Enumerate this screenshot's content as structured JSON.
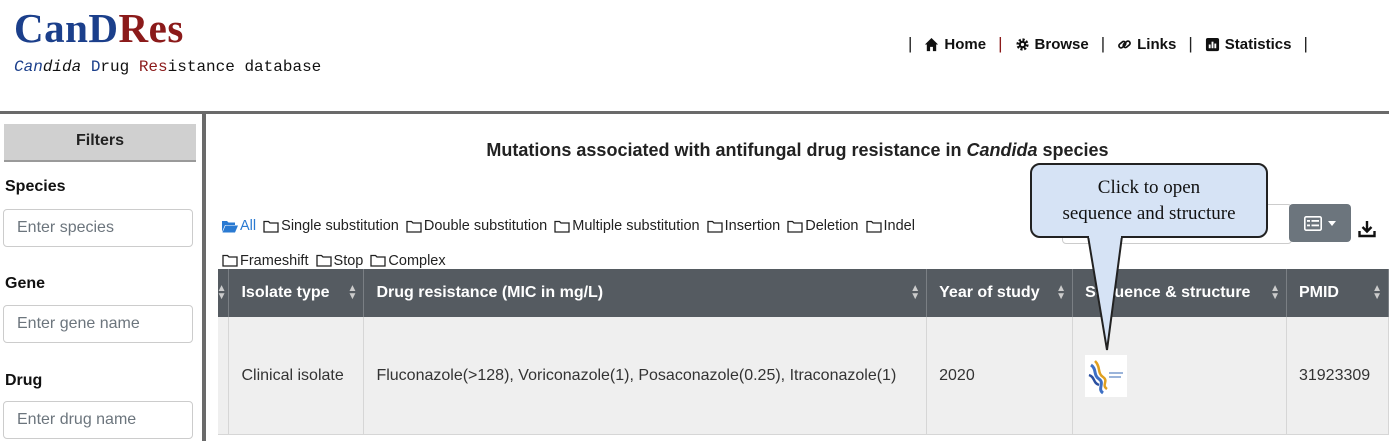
{
  "brand": {
    "logo_part1": "CanD",
    "logo_part2": "Res",
    "tagline_parts": [
      "Can",
      "dida",
      " D",
      "rug ",
      "Res",
      "istance database"
    ]
  },
  "nav": {
    "items": [
      {
        "label": "Home",
        "icon": "home-icon"
      },
      {
        "label": "Browse",
        "icon": "gear-icon"
      },
      {
        "label": "Links",
        "icon": "link-icon"
      },
      {
        "label": "Statistics",
        "icon": "bar-chart-icon"
      }
    ],
    "separator": "|"
  },
  "sidebar": {
    "title": "Filters",
    "filters": [
      {
        "label": "Species",
        "placeholder": "Enter species"
      },
      {
        "label": "Gene",
        "placeholder": "Enter gene name"
      },
      {
        "label": "Drug",
        "placeholder": "Enter drug name"
      }
    ]
  },
  "main": {
    "title_part1": "Mutations associated with antifungal drug resistance in ",
    "title_italic": "Candida",
    "title_part2": " species",
    "mutation_types": [
      "All",
      "Single substitution",
      "Double substitution",
      "Multiple substitution",
      "Insertion",
      "Deletion",
      "Indel",
      "Frameshift",
      "Stop",
      "Complex"
    ],
    "active_type": "All"
  },
  "table": {
    "headers": [
      "Isolate type",
      "Drug resistance (MIC in mg/L)",
      "Year of study",
      "Sequence & structure",
      "PMID"
    ],
    "rows": [
      {
        "isolate_type": "Clinical isolate",
        "drug_resistance": "Fluconazole(>128), Voriconazole(1), Posaconazole(0.25), Itraconazole(1)",
        "year": "2020",
        "pmid": "31923309"
      }
    ]
  },
  "callout": {
    "line1": "Click  to open",
    "line2": "sequence and structure"
  },
  "colors": {
    "brand_blue": "#1b3f8b",
    "brand_red": "#8b1a1a",
    "table_header": "#555b61",
    "link": "#3a63a6",
    "callout_bg": "#d6e3f5"
  }
}
